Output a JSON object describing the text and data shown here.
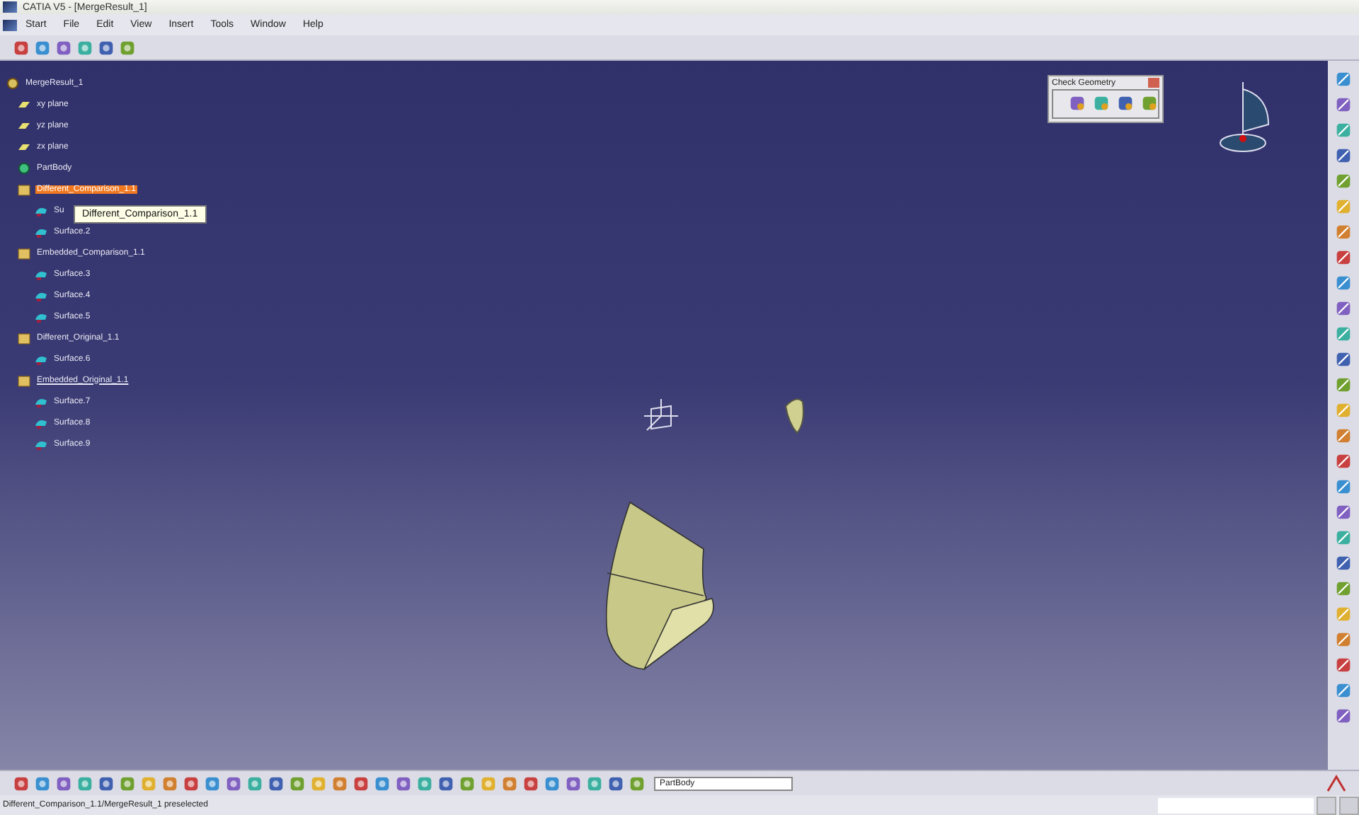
{
  "window": {
    "title": "CATIA V5 - [MergeResult_1]"
  },
  "menu": [
    "Start",
    "File",
    "Edit",
    "View",
    "Insert",
    "Tools",
    "Window",
    "Help"
  ],
  "tree": {
    "label": "MergeResult_1",
    "children": [
      {
        "label": "xy plane",
        "kind": "plane",
        "selected": false,
        "underlined": false
      },
      {
        "label": "yz plane",
        "kind": "plane",
        "selected": false,
        "underlined": false
      },
      {
        "label": "zx plane",
        "kind": "plane",
        "selected": false,
        "underlined": false
      },
      {
        "label": "PartBody",
        "kind": "body",
        "selected": false,
        "underlined": false
      },
      {
        "label": "Different_Comparison_1.1",
        "kind": "set",
        "selected": true,
        "underlined": false,
        "children": [
          {
            "label": "Su"
          },
          {
            "label": "Surface.2"
          }
        ]
      },
      {
        "label": "Embedded_Comparison_1.1",
        "kind": "set",
        "selected": false,
        "underlined": false,
        "children": [
          {
            "label": "Surface.3"
          },
          {
            "label": "Surface.4"
          },
          {
            "label": "Surface.5"
          }
        ]
      },
      {
        "label": "Different_Original_1.1",
        "kind": "set",
        "selected": false,
        "underlined": false,
        "children": [
          {
            "label": "Surface.6"
          }
        ]
      },
      {
        "label": "Embedded_Original_1.1",
        "kind": "set",
        "selected": false,
        "underlined": true,
        "children": [
          {
            "label": "Surface.7"
          },
          {
            "label": "Surface.8"
          },
          {
            "label": "Surface.9"
          }
        ]
      }
    ]
  },
  "tooltip": "Different_Comparison_1.1",
  "check_geometry": {
    "title": "Check Geometry"
  },
  "bottom_toolbar": {
    "dropdown": "PartBody"
  },
  "status_bar": "Different_Comparison_1.1/MergeResult_1 preselected"
}
